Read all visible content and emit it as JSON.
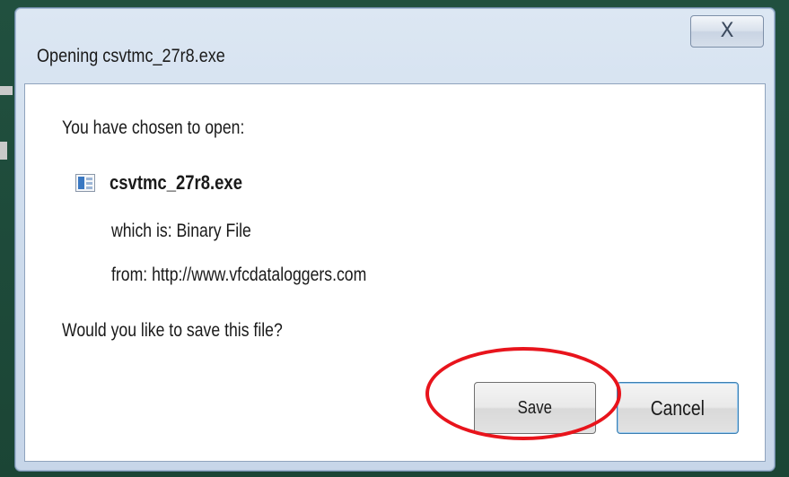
{
  "dialog": {
    "title": "Opening csvtmc_27r8.exe",
    "close_icon": "X"
  },
  "body": {
    "prompt": "You have chosen to open:",
    "file_name": "csvtmc_27r8.exe",
    "file_icon": "exe-file-icon",
    "which_is": "which is: Binary File",
    "from": "from: http://www.vfcdataloggers.com",
    "question": "Would you like to save this file?"
  },
  "buttons": {
    "save_label": "Save",
    "cancel_label": "Cancel"
  },
  "annotation": {
    "highlight_color": "#e8141c"
  }
}
